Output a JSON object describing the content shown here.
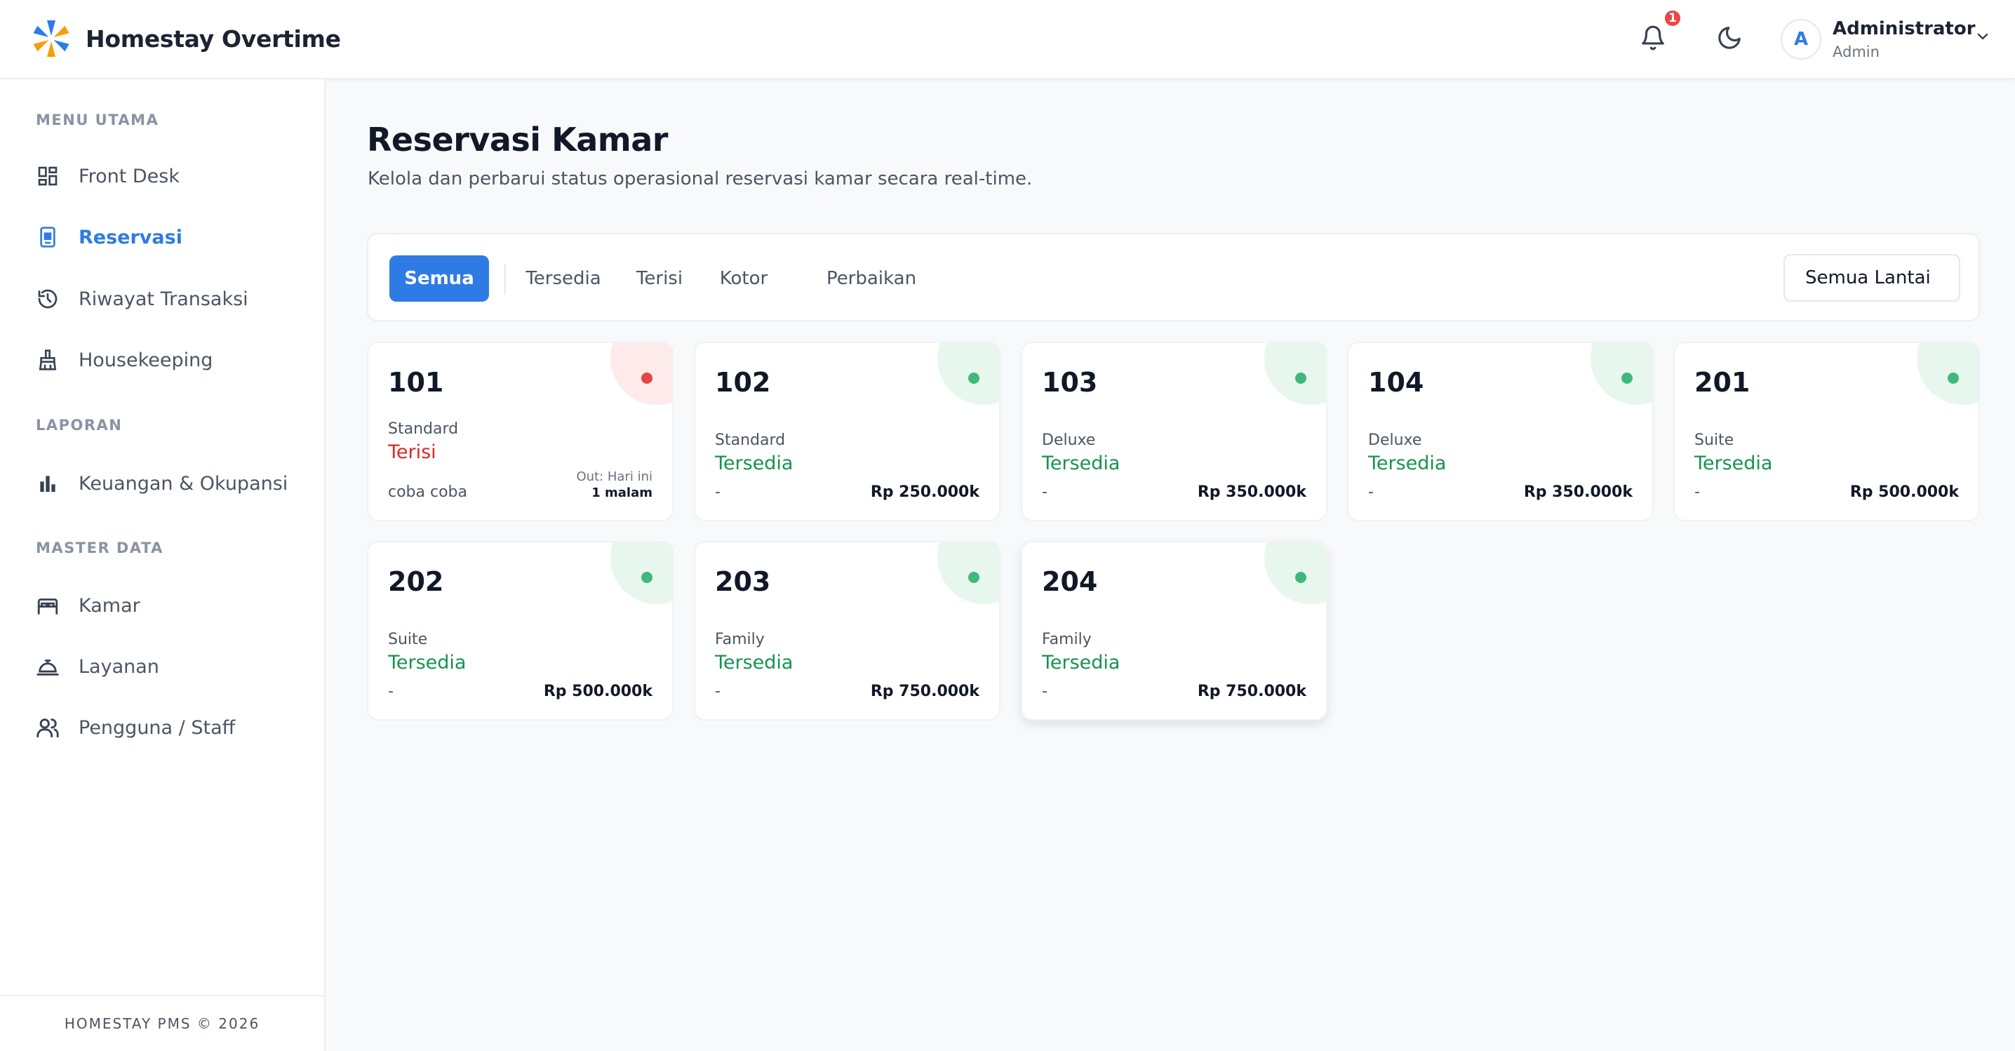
{
  "app": {
    "title": "Homestay Overtime"
  },
  "header": {
    "notification_count": "1",
    "user": {
      "initial": "A",
      "name": "Administrator",
      "role": "Admin"
    }
  },
  "sidebar": {
    "sections": [
      {
        "title": "MENU UTAMA",
        "items": [
          {
            "label": "Front Desk"
          },
          {
            "label": "Reservasi",
            "active": true
          },
          {
            "label": "Riwayat Transaksi"
          },
          {
            "label": "Housekeeping"
          }
        ]
      },
      {
        "title": "LAPORAN",
        "items": [
          {
            "label": "Keuangan & Okupansi"
          }
        ]
      },
      {
        "title": "MASTER DATA",
        "items": [
          {
            "label": "Kamar"
          },
          {
            "label": "Layanan"
          },
          {
            "label": "Pengguna / Staff"
          }
        ]
      }
    ],
    "footer": "HOMESTAY PMS © 2026"
  },
  "page": {
    "title": "Reservasi Kamar",
    "subtitle": "Kelola dan perbarui status operasional reservasi kamar secara real-time."
  },
  "filters": {
    "tabs": [
      {
        "label": "Semua",
        "active": true
      },
      {
        "label": "Tersedia"
      },
      {
        "label": "Terisi"
      },
      {
        "label": "Kotor"
      },
      {
        "label": "Perbaikan"
      }
    ],
    "floor_select": "Semua Lantai"
  },
  "rooms": [
    {
      "number": "101",
      "type": "Standard",
      "status": "Terisi",
      "guest": "coba coba",
      "checkout_label": "Out: Hari ini",
      "nights": "1 malam",
      "color": "#dc2626"
    },
    {
      "number": "102",
      "type": "Standard",
      "status": "Tersedia",
      "guest": "-",
      "price": "Rp 250.000k",
      "color": "#17934f"
    },
    {
      "number": "103",
      "type": "Deluxe",
      "status": "Tersedia",
      "guest": "-",
      "price": "Rp 350.000k",
      "color": "#17934f"
    },
    {
      "number": "104",
      "type": "Deluxe",
      "status": "Tersedia",
      "guest": "-",
      "price": "Rp 350.000k",
      "color": "#17934f"
    },
    {
      "number": "201",
      "type": "Suite",
      "status": "Tersedia",
      "guest": "-",
      "price": "Rp 500.000k",
      "color": "#17934f"
    },
    {
      "number": "202",
      "type": "Suite",
      "status": "Tersedia",
      "guest": "-",
      "price": "Rp 500.000k",
      "color": "#17934f"
    },
    {
      "number": "203",
      "type": "Family",
      "status": "Tersedia",
      "guest": "-",
      "price": "Rp 750.000k",
      "color": "#17934f"
    },
    {
      "number": "204",
      "type": "Family",
      "status": "Tersedia",
      "guest": "-",
      "price": "Rp 750.000k",
      "color": "#17934f"
    }
  ],
  "colors": {
    "accent": "#2f7be6",
    "occupied": "#dc2626",
    "available": "#17934f"
  }
}
